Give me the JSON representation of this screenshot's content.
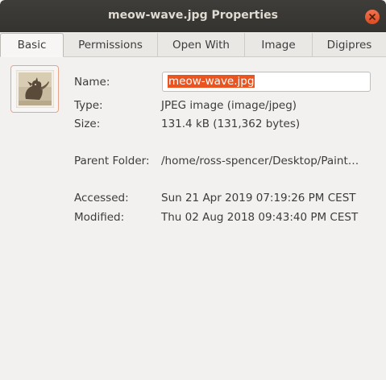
{
  "window": {
    "title": "meow-wave.jpg Properties"
  },
  "tabs": [
    {
      "label": "Basic"
    },
    {
      "label": "Permissions"
    },
    {
      "label": "Open With"
    },
    {
      "label": "Image"
    },
    {
      "label": "Digipres"
    }
  ],
  "basic": {
    "name_label": "Name:",
    "name_value": "meow-wave.jpg",
    "type_label": "Type:",
    "type_value": "JPEG image (image/jpeg)",
    "size_label": "Size:",
    "size_value": "131.4 kB (131,362 bytes)",
    "parent_label": "Parent Folder:",
    "parent_value": "/home/ross-spencer/Desktop/Paint…",
    "accessed_label": "Accessed:",
    "accessed_value": "Sun 21 Apr 2019 07:19:26 PM CEST",
    "modified_label": "Modified:",
    "modified_value": "Thu 02 Aug 2018 09:43:40 PM CEST"
  },
  "colors": {
    "titlebar": "#3a3935",
    "selection": "#e95420",
    "close": "#e65a2d"
  },
  "icons": {
    "close": "close-icon",
    "thumbnail": "file-thumbnail-icon"
  }
}
